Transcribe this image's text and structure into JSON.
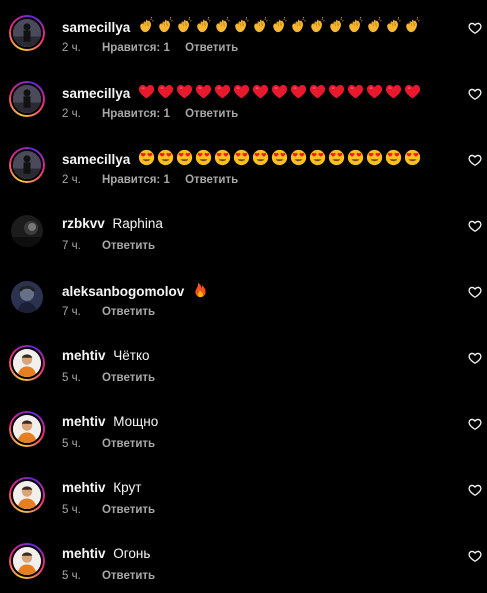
{
  "comments": [
    {
      "username": "samecillya",
      "text": "",
      "emoji": "clap",
      "emoji_count": 15,
      "time": "2 ч.",
      "likes": "Нравится: 1",
      "reply": "Ответить",
      "avatar": "dark-figure"
    },
    {
      "username": "samecillya",
      "text": "",
      "emoji": "red-heart",
      "emoji_count": 15,
      "time": "2 ч.",
      "likes": "Нравится: 1",
      "reply": "Ответить",
      "avatar": "dark-figure"
    },
    {
      "username": "samecillya",
      "text": "",
      "emoji": "heart-eyes",
      "emoji_count": 15,
      "time": "2 ч.",
      "likes": "Нравится: 1",
      "reply": "Ответить",
      "avatar": "dark-figure"
    },
    {
      "username": "rzbkvv",
      "text": "Raphina",
      "emoji": "",
      "emoji_count": 0,
      "time": "7 ч.",
      "likes": "",
      "reply": "Ответить",
      "avatar": "dark-portrait"
    },
    {
      "username": "aleksanbogomolov",
      "text": "",
      "emoji": "fire",
      "emoji_count": 1,
      "time": "7 ч.",
      "likes": "",
      "reply": "Ответить",
      "avatar": "blue-portrait"
    },
    {
      "username": "mehtiv",
      "text": "Чётко",
      "emoji": "",
      "emoji_count": 0,
      "time": "5 ч.",
      "likes": "",
      "reply": "Ответить",
      "avatar": "orange-person"
    },
    {
      "username": "mehtiv",
      "text": "Мощно",
      "emoji": "",
      "emoji_count": 0,
      "time": "5 ч.",
      "likes": "",
      "reply": "Ответить",
      "avatar": "orange-person"
    },
    {
      "username": "mehtiv",
      "text": "Крут",
      "emoji": "",
      "emoji_count": 0,
      "time": "5 ч.",
      "likes": "",
      "reply": "Ответить",
      "avatar": "orange-person"
    },
    {
      "username": "mehtiv",
      "text": "Огонь",
      "emoji": "",
      "emoji_count": 0,
      "time": "5 ч.",
      "likes": "",
      "reply": "Ответить",
      "avatar": "orange-person"
    }
  ],
  "colors": {
    "background": "#000000",
    "primary_text": "#f5f5f5",
    "secondary_text": "#a8a8a8",
    "heart_emoji": "#e8192c"
  },
  "icons": {
    "like": "heart-outline-icon"
  }
}
